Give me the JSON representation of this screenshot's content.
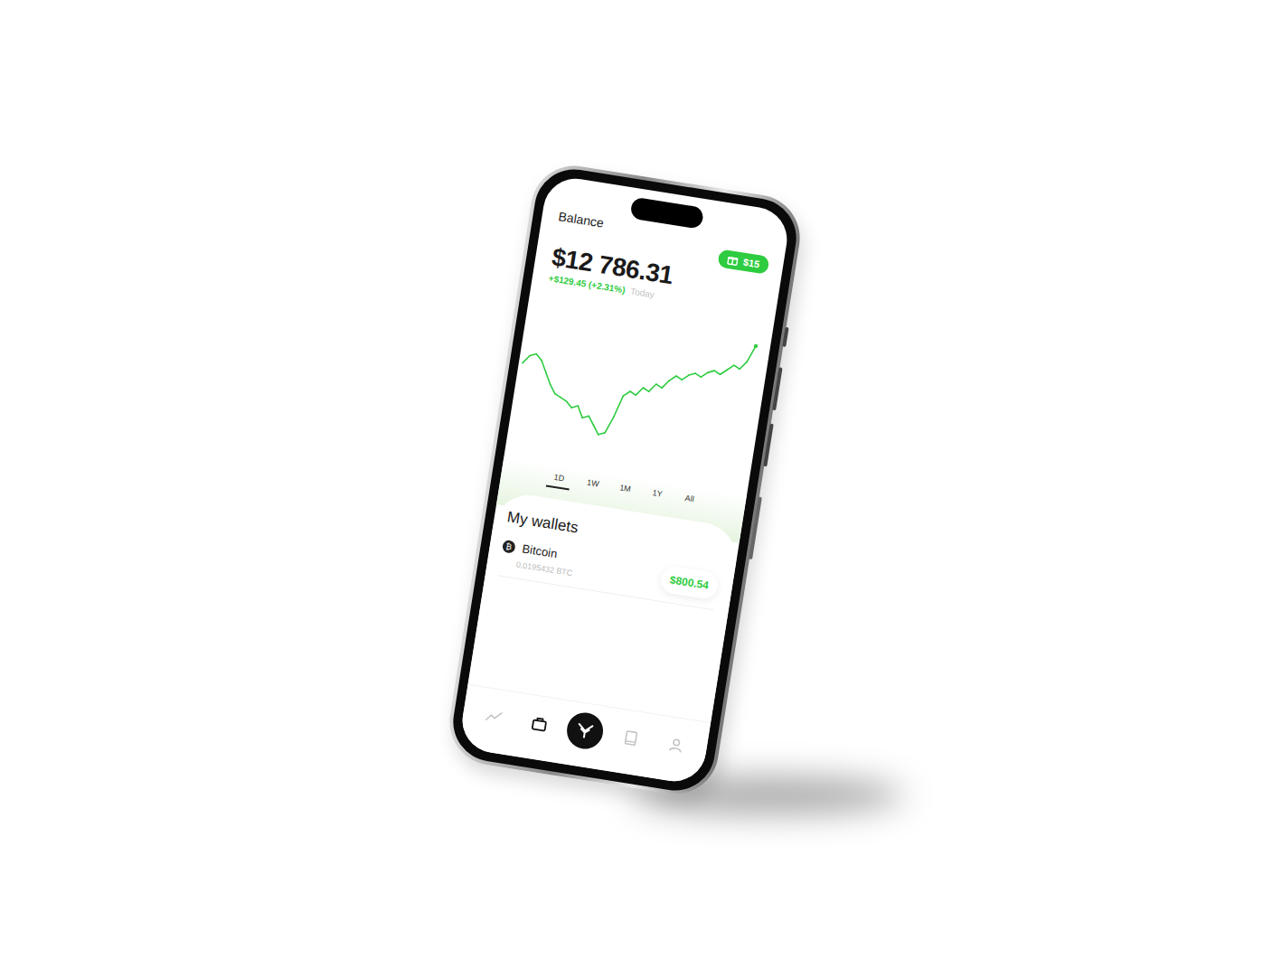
{
  "header": {
    "title": "Balance",
    "badge": "$15"
  },
  "balance": {
    "amount": "$12 786.31",
    "change": "+$129.45 (+2.31%)",
    "period": "Today"
  },
  "chart": {
    "values": [
      62,
      68,
      70,
      66,
      58,
      50,
      44,
      42,
      40,
      36,
      38,
      30,
      32,
      26,
      20,
      22,
      34,
      50,
      54,
      52,
      58,
      56,
      62,
      60,
      66,
      70,
      68,
      72,
      74,
      72,
      76,
      78,
      76,
      80,
      84,
      82,
      88,
      100
    ]
  },
  "ranges": [
    {
      "label": "1D",
      "selected": true
    },
    {
      "label": "1W",
      "selected": false
    },
    {
      "label": "1M",
      "selected": false
    },
    {
      "label": "1Y",
      "selected": false
    },
    {
      "label": "All",
      "selected": false
    }
  ],
  "wallets": {
    "title": "My wallets",
    "items": [
      {
        "name": "Bitcoin",
        "symbol": "₿",
        "amount": "0,0195432 BTC",
        "value": "$800.54"
      }
    ]
  },
  "nav": [
    {
      "kind": "trend",
      "selected": false
    },
    {
      "kind": "briefcase",
      "selected": true
    },
    {
      "kind": "logo",
      "selected": false
    },
    {
      "kind": "book",
      "selected": false
    },
    {
      "kind": "profile",
      "selected": false
    }
  ]
}
